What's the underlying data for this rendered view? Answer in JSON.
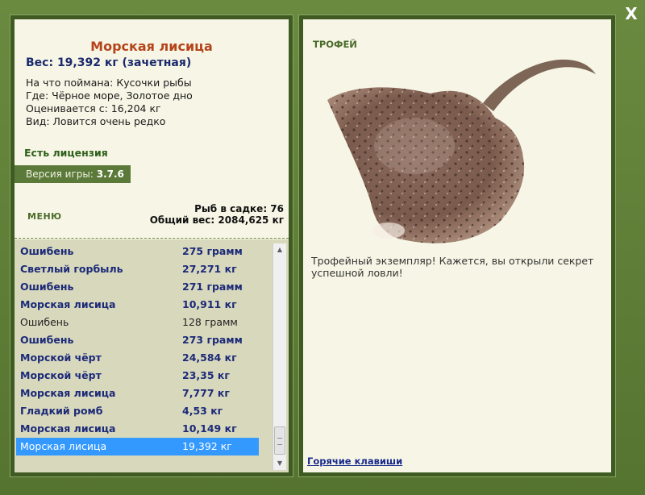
{
  "close_label": "X",
  "fish": {
    "title": "Морская лисица",
    "weight_line": "Вес: 19,392 кг (зачетная)",
    "info": [
      "На что поймана: Кусочки рыбы",
      "Где: Чёрное море, Золотое дно",
      "Оценивается с: 16,204 кг",
      "Вид: Ловится очень редко"
    ]
  },
  "license_text": "Есть лицензия",
  "version": {
    "label": "Версия игры: ",
    "value": "3.7.6"
  },
  "menu_label": "МЕНЮ",
  "stats": {
    "count_line": "Рыб в садке: 76",
    "total_line": "Общий вес: 2084,625 кг"
  },
  "catch_list": [
    {
      "name": "Ошибень",
      "weight": "275 грамм",
      "trophy": true,
      "selected": false
    },
    {
      "name": "Светлый горбыль",
      "weight": "27,271 кг",
      "trophy": true,
      "selected": false
    },
    {
      "name": "Ошибень",
      "weight": "271 грамм",
      "trophy": true,
      "selected": false
    },
    {
      "name": "Морская лисица",
      "weight": "10,911 кг",
      "trophy": true,
      "selected": false
    },
    {
      "name": "Ошибень",
      "weight": "128 грамм",
      "trophy": false,
      "selected": false
    },
    {
      "name": "Ошибень",
      "weight": "273 грамм",
      "trophy": true,
      "selected": false
    },
    {
      "name": "Морской чёрт",
      "weight": "24,584 кг",
      "trophy": true,
      "selected": false
    },
    {
      "name": "Морской чёрт",
      "weight": "23,35 кг",
      "trophy": true,
      "selected": false
    },
    {
      "name": "Морская лисица",
      "weight": "7,777 кг",
      "trophy": true,
      "selected": false
    },
    {
      "name": "Гладкий ромб",
      "weight": "4,53 кг",
      "trophy": true,
      "selected": false
    },
    {
      "name": "Морская лисица",
      "weight": "10,149 кг",
      "trophy": true,
      "selected": false
    },
    {
      "name": "Морская лисица",
      "weight": "19,392 кг",
      "trophy": false,
      "selected": true
    }
  ],
  "trophy_label": "ТРОФЕЙ",
  "trophy_text": "Трофейный экземпляр! Кажется, вы открыли секрет успешной ловли!",
  "hotkeys_label": "Горячие клавиши",
  "colors": {
    "frame_green": "#5d7d37",
    "panel_bg": "#f7f6e6",
    "title_orange": "#b5441a",
    "trophy_blue": "#1c2a78",
    "selected_blue": "#3399ff"
  }
}
